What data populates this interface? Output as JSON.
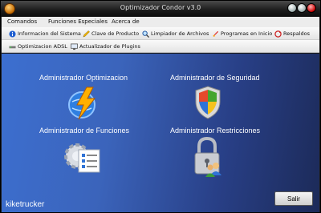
{
  "window": {
    "title": "Optimizador Condor v3.0"
  },
  "menu": {
    "items": [
      "Comandos",
      "Funciones Especiales",
      "Acerca de"
    ]
  },
  "toolbar1": {
    "items": [
      {
        "label": "Informacion del Sistema",
        "icon": "info-icon"
      },
      {
        "label": "Clave de Producto",
        "icon": "key-pencil-icon"
      },
      {
        "label": "Limpiador de Archivos",
        "icon": "magnifier-icon"
      },
      {
        "label": "Programas en Inicio",
        "icon": "rocket-icon"
      },
      {
        "label": "Respaldos",
        "icon": "backup-icon"
      }
    ]
  },
  "toolbar2": {
    "items": [
      {
        "label": "Optimizacion ADSL",
        "icon": "network-icon"
      },
      {
        "label": "Actualizador de Plugins",
        "icon": "monitor-icon"
      }
    ]
  },
  "main": {
    "tools": [
      {
        "label": "Administrador Optimizacion",
        "icon": "lightning-globe-icon"
      },
      {
        "label": "Administrador de Seguridad",
        "icon": "shield-icon"
      },
      {
        "label": "Administrador de Funciones",
        "icon": "gear-checklist-icon"
      },
      {
        "label": "Administrador Restricciones",
        "icon": "padlock-users-icon"
      }
    ],
    "watermark": "kiketrucker",
    "exit_label": "Salir"
  },
  "colors": {
    "titlebar": "#1e1e1e",
    "main_gradient_start": "#3c6fd0",
    "main_gradient_end": "#1c2a58"
  }
}
